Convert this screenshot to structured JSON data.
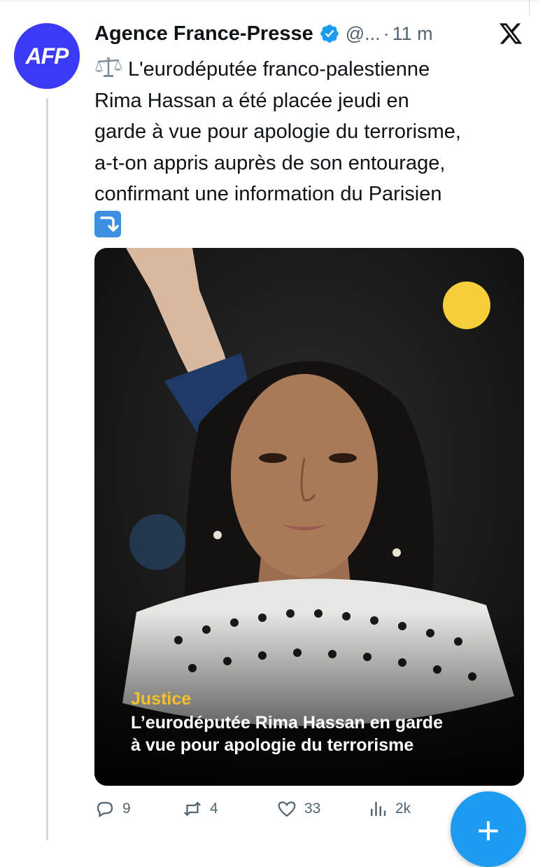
{
  "post": {
    "author_name": "Agence France-Presse",
    "handle": "@...",
    "separator": "·",
    "time": "11 m",
    "avatar_text": "AFP",
    "icons": [
      "verified-badge-icon",
      "x-logo-icon",
      "balance-scale-emoji",
      "arrow-down-right-emoji"
    ],
    "text_lines": [
      "L'eurodéputée franco-palestienne",
      "Rima Hassan a été placée jeudi en",
      "garde à vue pour apologie du terrorisme,",
      "a-t-on appris auprès de son entourage,",
      "confirmant une information du Parisien"
    ]
  },
  "media": {
    "category": "Justice",
    "headline_line1": "L’eurodéputée Rima Hassan en garde",
    "headline_line2": "à vue pour apologie du terrorisme",
    "accent_color": "#f6ce3c"
  },
  "actions": {
    "replies": "9",
    "reposts": "4",
    "likes": "33",
    "views": "2k",
    "icons": [
      "reply-icon",
      "repost-icon",
      "like-icon",
      "views-icon",
      "plus-icon"
    ]
  },
  "colors": {
    "brand_blue": "#1d9bf0",
    "avatar_blue": "#3b3bf5",
    "muted_text": "#536471"
  }
}
